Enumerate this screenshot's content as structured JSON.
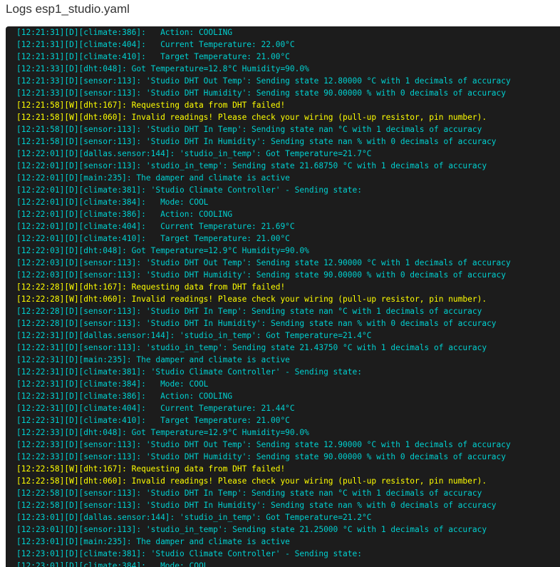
{
  "title": "Logs esp1_studio.yaml",
  "colors": {
    "debug": "#00d0d0",
    "warning": "#ffff00",
    "background": "#1c1c1c"
  },
  "log_lines": [
    {
      "level": "D",
      "text": "[12:21:31][D][climate:386]:   Action: COOLING"
    },
    {
      "level": "D",
      "text": "[12:21:31][D][climate:404]:   Current Temperature: 22.00°C"
    },
    {
      "level": "D",
      "text": "[12:21:31][D][climate:410]:   Target Temperature: 21.00°C"
    },
    {
      "level": "D",
      "text": "[12:21:33][D][dht:048]: Got Temperature=12.8°C Humidity=90.0%"
    },
    {
      "level": "D",
      "text": "[12:21:33][D][sensor:113]: 'Studio DHT Out Temp': Sending state 12.80000 °C with 1 decimals of accuracy"
    },
    {
      "level": "D",
      "text": "[12:21:33][D][sensor:113]: 'Studio DHT Humidity': Sending state 90.00000 % with 0 decimals of accuracy"
    },
    {
      "level": "W",
      "text": "[12:21:58][W][dht:167]: Requesting data from DHT failed!"
    },
    {
      "level": "W",
      "text": "[12:21:58][W][dht:060]: Invalid readings! Please check your wiring (pull-up resistor, pin number)."
    },
    {
      "level": "D",
      "text": "[12:21:58][D][sensor:113]: 'Studio DHT In Temp': Sending state nan °C with 1 decimals of accuracy"
    },
    {
      "level": "D",
      "text": "[12:21:58][D][sensor:113]: 'Studio DHT In Humidity': Sending state nan % with 0 decimals of accuracy"
    },
    {
      "level": "D",
      "text": "[12:22:01][D][dallas.sensor:144]: 'studio_in_temp': Got Temperature=21.7°C"
    },
    {
      "level": "D",
      "text": "[12:22:01][D][sensor:113]: 'studio_in_temp': Sending state 21.68750 °C with 1 decimals of accuracy"
    },
    {
      "level": "D",
      "text": "[12:22:01][D][main:235]: The damper and climate is active"
    },
    {
      "level": "D",
      "text": "[12:22:01][D][climate:381]: 'Studio Climate Controller' - Sending state:"
    },
    {
      "level": "D",
      "text": "[12:22:01][D][climate:384]:   Mode: COOL"
    },
    {
      "level": "D",
      "text": "[12:22:01][D][climate:386]:   Action: COOLING"
    },
    {
      "level": "D",
      "text": "[12:22:01][D][climate:404]:   Current Temperature: 21.69°C"
    },
    {
      "level": "D",
      "text": "[12:22:01][D][climate:410]:   Target Temperature: 21.00°C"
    },
    {
      "level": "D",
      "text": "[12:22:03][D][dht:048]: Got Temperature=12.9°C Humidity=90.0%"
    },
    {
      "level": "D",
      "text": "[12:22:03][D][sensor:113]: 'Studio DHT Out Temp': Sending state 12.90000 °C with 1 decimals of accuracy"
    },
    {
      "level": "D",
      "text": "[12:22:03][D][sensor:113]: 'Studio DHT Humidity': Sending state 90.00000 % with 0 decimals of accuracy"
    },
    {
      "level": "W",
      "text": "[12:22:28][W][dht:167]: Requesting data from DHT failed!"
    },
    {
      "level": "W",
      "text": "[12:22:28][W][dht:060]: Invalid readings! Please check your wiring (pull-up resistor, pin number)."
    },
    {
      "level": "D",
      "text": "[12:22:28][D][sensor:113]: 'Studio DHT In Temp': Sending state nan °C with 1 decimals of accuracy"
    },
    {
      "level": "D",
      "text": "[12:22:28][D][sensor:113]: 'Studio DHT In Humidity': Sending state nan % with 0 decimals of accuracy"
    },
    {
      "level": "D",
      "text": "[12:22:31][D][dallas.sensor:144]: 'studio_in_temp': Got Temperature=21.4°C"
    },
    {
      "level": "D",
      "text": "[12:22:31][D][sensor:113]: 'studio_in_temp': Sending state 21.43750 °C with 1 decimals of accuracy"
    },
    {
      "level": "D",
      "text": "[12:22:31][D][main:235]: The damper and climate is active"
    },
    {
      "level": "D",
      "text": "[12:22:31][D][climate:381]: 'Studio Climate Controller' - Sending state:"
    },
    {
      "level": "D",
      "text": "[12:22:31][D][climate:384]:   Mode: COOL"
    },
    {
      "level": "D",
      "text": "[12:22:31][D][climate:386]:   Action: COOLING"
    },
    {
      "level": "D",
      "text": "[12:22:31][D][climate:404]:   Current Temperature: 21.44°C"
    },
    {
      "level": "D",
      "text": "[12:22:31][D][climate:410]:   Target Temperature: 21.00°C"
    },
    {
      "level": "D",
      "text": "[12:22:33][D][dht:048]: Got Temperature=12.9°C Humidity=90.0%"
    },
    {
      "level": "D",
      "text": "[12:22:33][D][sensor:113]: 'Studio DHT Out Temp': Sending state 12.90000 °C with 1 decimals of accuracy"
    },
    {
      "level": "D",
      "text": "[12:22:33][D][sensor:113]: 'Studio DHT Humidity': Sending state 90.00000 % with 0 decimals of accuracy"
    },
    {
      "level": "W",
      "text": "[12:22:58][W][dht:167]: Requesting data from DHT failed!"
    },
    {
      "level": "W",
      "text": "[12:22:58][W][dht:060]: Invalid readings! Please check your wiring (pull-up resistor, pin number)."
    },
    {
      "level": "D",
      "text": "[12:22:58][D][sensor:113]: 'Studio DHT In Temp': Sending state nan °C with 1 decimals of accuracy"
    },
    {
      "level": "D",
      "text": "[12:22:58][D][sensor:113]: 'Studio DHT In Humidity': Sending state nan % with 0 decimals of accuracy"
    },
    {
      "level": "D",
      "text": "[12:23:01][D][dallas.sensor:144]: 'studio_in_temp': Got Temperature=21.2°C"
    },
    {
      "level": "D",
      "text": "[12:23:01][D][sensor:113]: 'studio_in_temp': Sending state 21.25000 °C with 1 decimals of accuracy"
    },
    {
      "level": "D",
      "text": "[12:23:01][D][main:235]: The damper and climate is active"
    },
    {
      "level": "D",
      "text": "[12:23:01][D][climate:381]: 'Studio Climate Controller' - Sending state:"
    },
    {
      "level": "D",
      "text": "[12:23:01][D][climate:384]:   Mode: COOL"
    }
  ]
}
